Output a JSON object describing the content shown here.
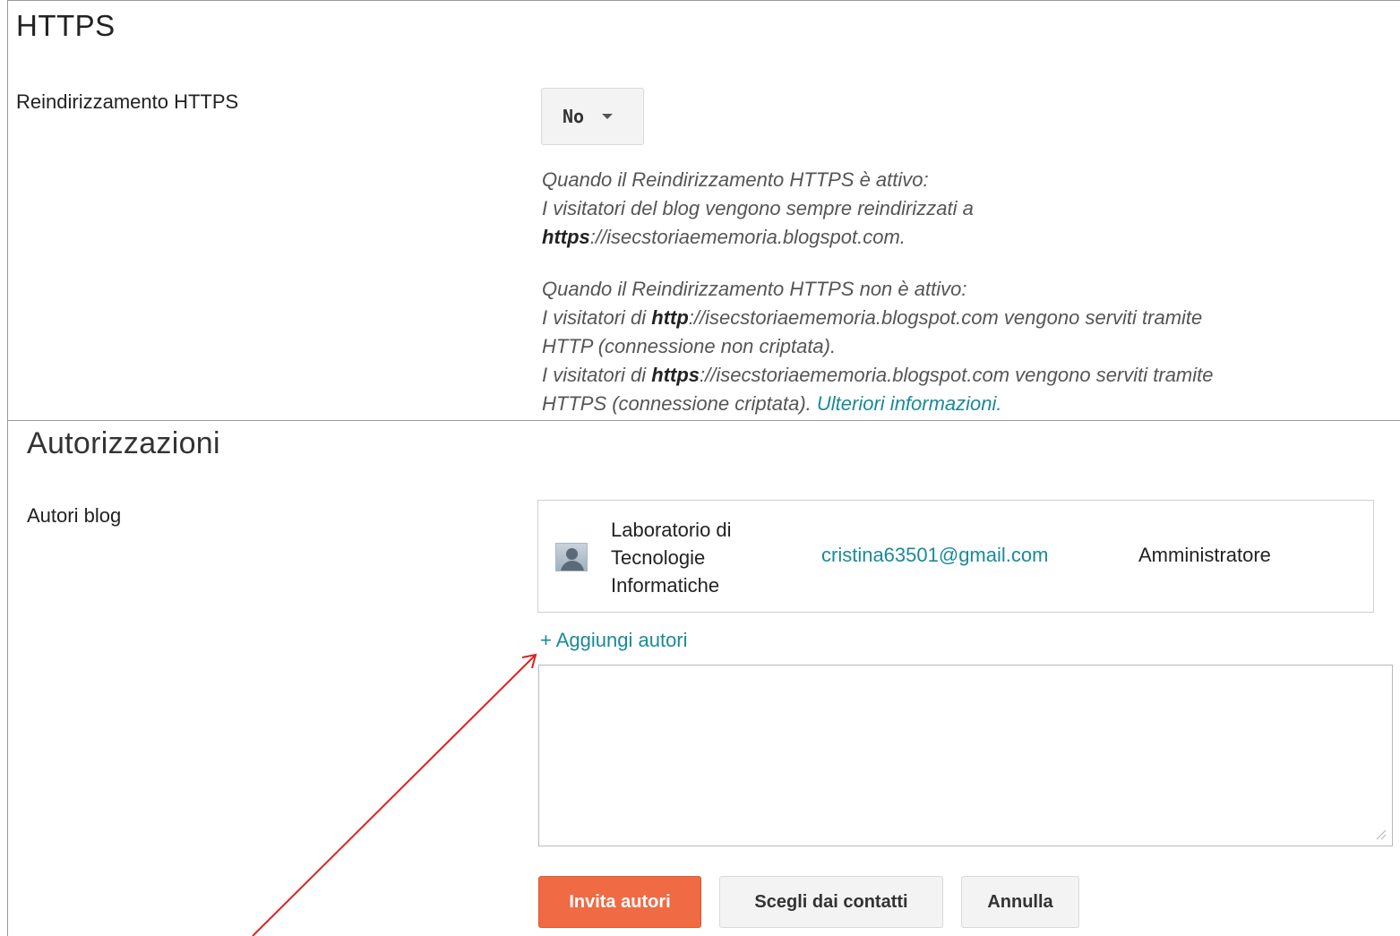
{
  "https_section": {
    "title": "HTTPS",
    "redirect_label": "Reindirizzamento HTTPS",
    "redirect_value": "No",
    "help_on": {
      "line1": "Quando il Reindirizzamento HTTPS è attivo:",
      "line2": "I visitatori del blog vengono sempre reindirizzati a",
      "line3_bold": "https",
      "line3_rest": "://isecstoriaememoria.blogspot.com."
    },
    "help_off": {
      "line1": "Quando il Reindirizzamento HTTPS non è attivo:",
      "line2_pre": "I visitatori di ",
      "line2_bold": "http",
      "line2_rest": "://isecstoriaememoria.blogspot.com vengono serviti tramite",
      "line3": "HTTP (connessione non criptata).",
      "line4_pre": "I visitatori di ",
      "line4_bold": "https",
      "line4_rest": "://isecstoriaememoria.blogspot.com vengono serviti tramite",
      "line5": "HTTPS (connessione criptata). ",
      "more_link": "Ulteriori informazioni."
    }
  },
  "permissions_section": {
    "title": "Autorizzazioni",
    "authors_label": "Autori blog",
    "author": {
      "name": "Laboratorio di Tecnologie Informatiche",
      "email": "cristina63501@gmail.com",
      "role": "Amministratore"
    },
    "add_authors_link": "+ Aggiungi autori",
    "invite_textarea_value": "",
    "buttons": {
      "invite": "Invita autori",
      "choose_contacts": "Scegli dai contatti",
      "cancel": "Annulla"
    }
  },
  "colors": {
    "accent_link": "#1a8a9a",
    "primary_button": "#f06a44",
    "annotation_arrow": "#e02020"
  }
}
